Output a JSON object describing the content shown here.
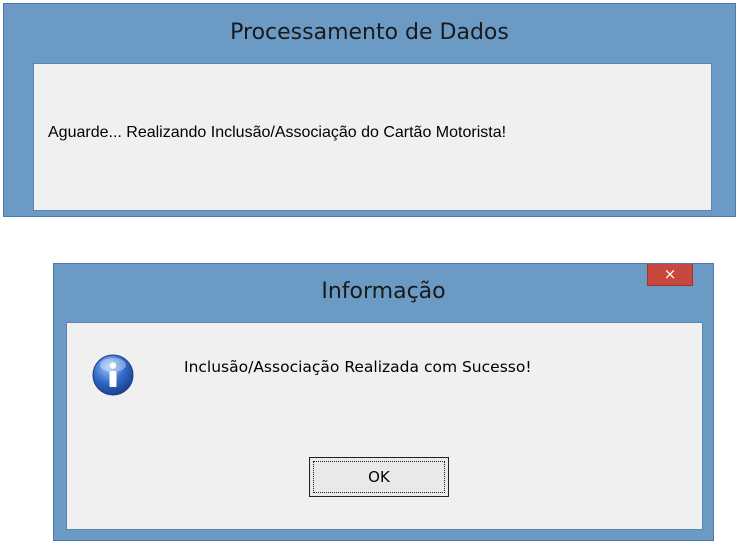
{
  "processing_dialog": {
    "title": "Processamento de Dados",
    "message": "Aguarde... Realizando Inclusão/Associação do Cartão Motorista!"
  },
  "info_dialog": {
    "title": "Informação",
    "close_glyph": "×",
    "icon": "info-icon",
    "message": "Inclusão/Associação Realizada com Sucesso!",
    "ok_label": "OK"
  },
  "colors": {
    "title_bar": "#6b9ac5",
    "client_area": "#f0f0f0",
    "close_button": "#c9483e",
    "info_icon": "#2a5db0"
  }
}
